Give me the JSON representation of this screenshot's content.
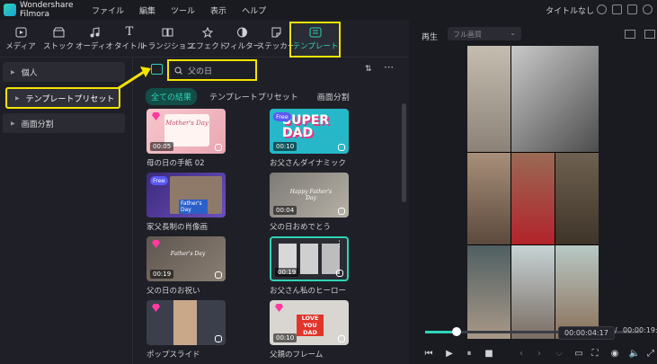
{
  "app": {
    "name": "Wondershare Filmora",
    "project_title": "タイトルなし"
  },
  "menu": [
    "ファイル",
    "編集",
    "ツール",
    "表示",
    "ヘルプ"
  ],
  "toolbar": [
    {
      "label": "メディア",
      "icon": "media-icon"
    },
    {
      "label": "ストック",
      "icon": "stock-icon"
    },
    {
      "label": "オーディオ",
      "icon": "audio-icon"
    },
    {
      "label": "タイトル",
      "icon": "title-icon"
    },
    {
      "label": "トランジション",
      "icon": "transition-icon"
    },
    {
      "label": "エフェクト",
      "icon": "effect-icon"
    },
    {
      "label": "フィルター",
      "icon": "filter-icon"
    },
    {
      "label": "ステッカー",
      "icon": "sticker-icon"
    },
    {
      "label": "テンプレート",
      "icon": "template-icon"
    }
  ],
  "sidebar": [
    {
      "label": "個人"
    },
    {
      "label": "テンプレートプリセット"
    },
    {
      "label": "画面分割"
    }
  ],
  "search": {
    "value": "父の日"
  },
  "tabs": [
    {
      "label": "全ての結果"
    },
    {
      "label": "テンプレートプリセット"
    },
    {
      "label": "画面分割"
    }
  ],
  "cards": [
    {
      "name": "母の日の手紙 02",
      "duration": "00:05",
      "badge": ""
    },
    {
      "name": "お父さんダイナミック",
      "duration": "00:10",
      "badge": "Free"
    },
    {
      "name": "家父長制の肖像画",
      "duration": "",
      "badge": "Free"
    },
    {
      "name": "父の日おめでとう",
      "duration": "00:04",
      "badge": ""
    },
    {
      "name": "父の日のお祝い",
      "duration": "00:19",
      "badge": ""
    },
    {
      "name": "お父さん私のヒーロー",
      "duration": "00:19",
      "badge": ""
    },
    {
      "name": "ポップスライド",
      "duration": "",
      "badge": ""
    },
    {
      "name": "父親のフレーム",
      "duration": "00:10",
      "badge": ""
    }
  ],
  "card_texts": [
    "Mother's Day",
    "SUPER DAD",
    "Father's Day",
    "Happy Father's Day",
    "LOVE YOU DAD"
  ],
  "player": {
    "tab": "再生",
    "quality": "フル画質",
    "current_time": "00:00:04:17",
    "total_time": "00:00:19:"
  },
  "colors": {
    "accent": "#2fd4b6",
    "highlight": "#f5e400",
    "bg": "#1f2027"
  }
}
